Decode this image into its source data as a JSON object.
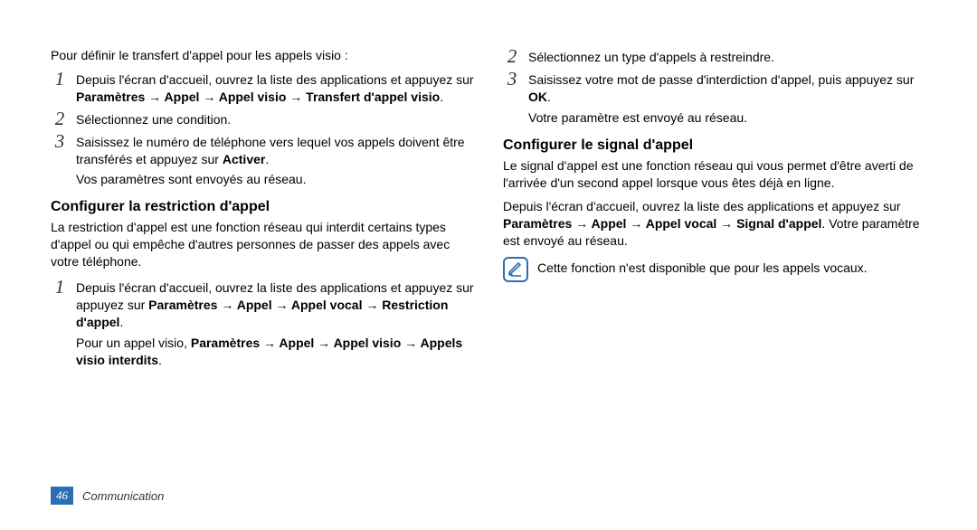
{
  "left": {
    "intro": "Pour définir le transfert d'appel pour les appels visio :",
    "steps": [
      {
        "run": [
          {
            "t": "Depuis l'écran d'accueil, ouvrez la liste des applications et  appuyez sur "
          },
          {
            "t": "Paramètres",
            "b": true
          },
          {
            "t": " → ",
            "b": true
          },
          {
            "t": "Appel",
            "b": true
          },
          {
            "t": " → ",
            "b": true
          },
          {
            "t": "Appel visio",
            "b": true
          },
          {
            "t": " → ",
            "b": true
          },
          {
            "t": "Transfert d'appel visio",
            "b": true
          },
          {
            "t": "."
          }
        ]
      },
      {
        "run": [
          {
            "t": "Sélectionnez une condition."
          }
        ]
      },
      {
        "run": [
          {
            "t": "Saisissez le numéro de téléphone vers lequel vos appels doivent être transférés et appuyez sur "
          },
          {
            "t": "Activer",
            "b": true
          },
          {
            "t": "."
          }
        ],
        "note": "Vos paramètres sont envoyés au réseau."
      }
    ],
    "h_restrict": "Configurer la restriction d'appel",
    "restrict_para": "La restriction d'appel est une fonction réseau qui interdit certains types d'appel ou qui empêche d'autres personnes de passer des appels avec votre téléphone.",
    "restrict_steps": [
      {
        "run": [
          {
            "t": "Depuis l'écran d'accueil, ouvrez la liste des applications et appuyez sur  appuyez sur "
          },
          {
            "t": "Paramètres",
            "b": true
          },
          {
            "t": " → ",
            "b": true
          },
          {
            "t": "Appel",
            "b": true
          },
          {
            "t": " → ",
            "b": true
          },
          {
            "t": "Appel vocal",
            "b": true
          },
          {
            "t": " → ",
            "b": true
          },
          {
            "t": "Restriction d'appel",
            "b": true
          },
          {
            "t": "."
          }
        ],
        "extra": [
          {
            "t": "Pour un appel visio,  "
          },
          {
            "t": "Paramètres",
            "b": true
          },
          {
            "t": " → ",
            "b": true
          },
          {
            "t": "Appel",
            "b": true
          },
          {
            "t": " → ",
            "b": true
          },
          {
            "t": "Appel visio",
            "b": true
          },
          {
            "t": " → ",
            "b": true
          },
          {
            "t": "Appels visio interdits",
            "b": true
          },
          {
            "t": "."
          }
        ]
      }
    ]
  },
  "right": {
    "steps": [
      {
        "num": "2",
        "run": [
          {
            "t": "Sélectionnez un type d'appels à restreindre."
          }
        ]
      },
      {
        "num": "3",
        "run": [
          {
            "t": "Saisissez votre mot de passe d'interdiction d'appel, puis appuyez sur "
          },
          {
            "t": "OK",
            "b": true
          },
          {
            "t": "."
          }
        ],
        "note": "Votre paramètre est envoyé au réseau."
      }
    ],
    "h_signal": "Configurer le signal d'appel",
    "signal_para": "Le signal d'appel est une fonction réseau qui vous permet d'être averti de l'arrivée d'un second appel lorsque vous êtes déjà en ligne.",
    "signal_nav": [
      {
        "t": "Depuis l'écran d'accueil, ouvrez la liste des applications et appuyez sur "
      },
      {
        "t": "Paramètres",
        "b": true
      },
      {
        "t": " → ",
        "b": true
      },
      {
        "t": "Appel",
        "b": true
      },
      {
        "t": " → ",
        "b": true
      },
      {
        "t": "Appel vocal",
        "b": true
      },
      {
        "t": " → ",
        "b": true
      },
      {
        "t": "Signal d'appel",
        "b": true
      },
      {
        "t": ". Votre paramètre est envoyé au réseau."
      }
    ],
    "note": "Cette fonction n'est disponible que pour les appels vocaux."
  },
  "footer": {
    "page": "46",
    "section": "Communication"
  },
  "icons": {
    "note": "note-icon"
  }
}
